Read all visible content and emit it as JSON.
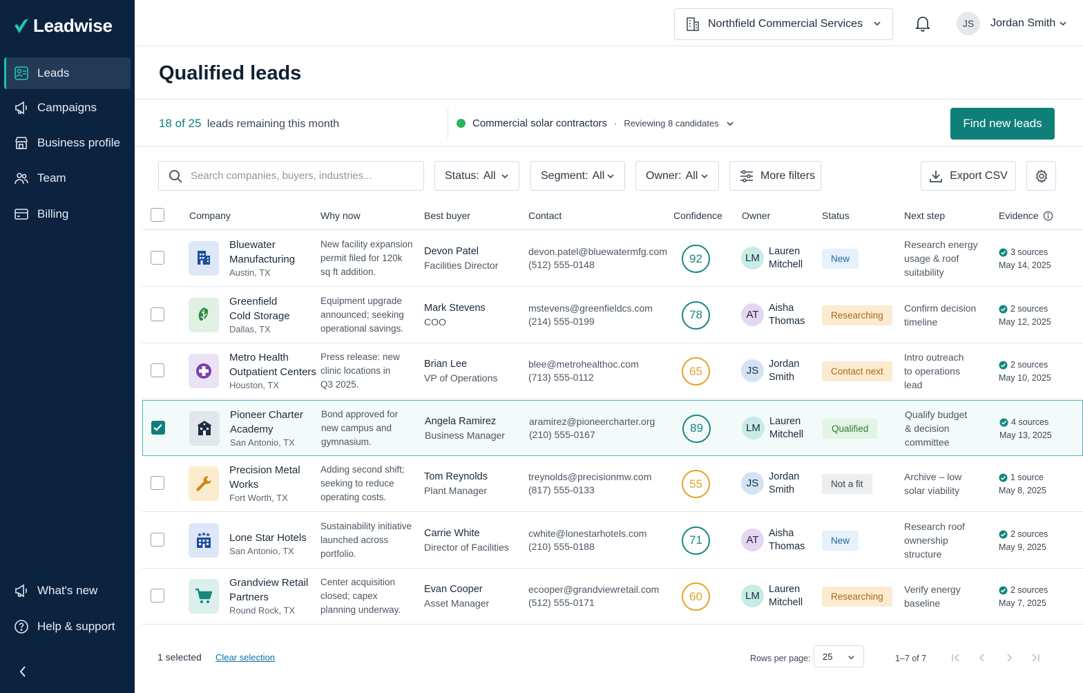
{
  "app": {
    "name": "Leadwise"
  },
  "nav": {
    "items": [
      {
        "label": "Leads",
        "icon": "leads-icon",
        "active": true
      },
      {
        "label": "Campaigns",
        "icon": "megaphone-icon"
      },
      {
        "label": "Business profile",
        "icon": "storefront-icon"
      },
      {
        "label": "Team",
        "icon": "team-icon"
      },
      {
        "label": "Billing",
        "icon": "credit-card-icon"
      }
    ],
    "bottom": [
      {
        "label": "What's new",
        "icon": "megaphone-icon"
      },
      {
        "label": "Help & support",
        "icon": "help-circle-icon"
      }
    ]
  },
  "topbar": {
    "org": "Northfield Commercial Services",
    "user_initials": "JS",
    "user_name": "Jordan Smith"
  },
  "page": {
    "title": "Qualified leads"
  },
  "summary": {
    "quota_count": "18 of 25",
    "quota_text": "leads remaining this month",
    "campaign_name": "Commercial solar contractors",
    "campaign_status": "Reviewing 8 candidates",
    "find_button": "Find new leads"
  },
  "toolbar": {
    "search_placeholder": "Search companies, buyers, industries...",
    "status_filter": {
      "label": "Status:",
      "value": "All"
    },
    "segment_filter": {
      "label": "Segment:",
      "value": "All"
    },
    "owner_filter": {
      "label": "Owner:",
      "value": "All"
    },
    "more_filters": "More filters",
    "export": "Export CSV"
  },
  "table": {
    "columns": [
      "Company",
      "Why now",
      "Best buyer",
      "Contact",
      "Confidence",
      "Owner",
      "Status",
      "Next step",
      "Evidence"
    ],
    "rows": [
      {
        "company": [
          "Bluewater",
          "Manufacturing"
        ],
        "location": "Austin, TX",
        "logo_icon": "building-icon",
        "logo_bg": "#dde7f7",
        "logo_color": "#1f4fa0",
        "why": [
          "New facility expansion",
          "permit filed for 120k",
          "sq ft addition."
        ],
        "buyer": "Devon Patel",
        "buyer_title": "Facilities Director",
        "email": "devon.patel@bluewatermfg.com",
        "phone": "(512) 555-0148",
        "confidence": 92,
        "owner_initials": "LM",
        "owner": [
          "Lauren",
          "Mitchell"
        ],
        "status": "New",
        "next": [
          "Research energy",
          "usage & roof",
          "suitability"
        ],
        "sources": "3 sources",
        "date": "May 14, 2025",
        "selected": false
      },
      {
        "company": [
          "Greenfield",
          "Cold Storage"
        ],
        "location": "Dallas, TX",
        "logo_icon": "leaf-icon",
        "logo_bg": "#e0f1e4",
        "logo_color": "#2f8a45",
        "why": [
          "Equipment upgrade",
          "announced; seeking",
          "operational savings."
        ],
        "buyer": "Mark Stevens",
        "buyer_title": "COO",
        "email": "mstevens@greenfieldcs.com",
        "phone": "(214) 555-0199",
        "confidence": 78,
        "owner_initials": "AT",
        "owner": [
          "Aisha",
          "Thomas"
        ],
        "status": "Researching",
        "next": [
          "Confirm decision",
          "timeline"
        ],
        "sources": "2 sources",
        "date": "May 12, 2025",
        "selected": false
      },
      {
        "company": [
          "Metro Health",
          "Outpatient Centers"
        ],
        "location": "Houston, TX",
        "logo_icon": "medical-cross-icon",
        "logo_bg": "#ece2f6",
        "logo_color": "#7a3fb0",
        "why": [
          "Press release: new",
          "clinic locations in",
          "Q3 2025."
        ],
        "buyer": "Brian Lee",
        "buyer_title": "VP of Operations",
        "email": "blee@metrohealthoc.com",
        "phone": "(713) 555-0112",
        "confidence": 65,
        "owner_initials": "JS",
        "owner": [
          "Jordan",
          "Smith"
        ],
        "status": "Contact next",
        "next": [
          "Intro outreach",
          "to operations",
          "lead"
        ],
        "sources": "2 sources",
        "date": "May 10, 2025",
        "selected": false
      },
      {
        "company": [
          "Pioneer Charter",
          "Academy"
        ],
        "location": "San Antonio, TX",
        "logo_icon": "school-icon",
        "logo_bg": "#e3e6ea",
        "logo_color": "#1d2f45",
        "why": [
          "Bond approved for",
          "new campus and",
          "gymnasium."
        ],
        "buyer": "Angela Ramirez",
        "buyer_title": "Business Manager",
        "email": "aramirez@pioneercharter.org",
        "phone": "(210) 555-0167",
        "confidence": 89,
        "owner_initials": "LM",
        "owner": [
          "Lauren",
          "Mitchell"
        ],
        "status": "Qualified",
        "next": [
          "Qualify budget",
          "& decision",
          "committee"
        ],
        "sources": "4 sources",
        "date": "May 13, 2025",
        "selected": true
      },
      {
        "company": [
          "Precision Metal",
          "Works"
        ],
        "location": "Fort Worth, TX",
        "logo_icon": "wrench-icon",
        "logo_bg": "#fbeccd",
        "logo_color": "#c9891c",
        "why": [
          "Adding second shift;",
          "seeking to reduce",
          "operating costs."
        ],
        "buyer": "Tom Reynolds",
        "buyer_title": "Plant Manager",
        "email": "treynolds@precisionmw.com",
        "phone": "(817) 555-0133",
        "confidence": 55,
        "owner_initials": "JS",
        "owner": [
          "Jordan",
          "Smith"
        ],
        "status": "Not a fit",
        "next": [
          "Archive – low",
          "solar viability"
        ],
        "sources": "1 source",
        "date": "May 8, 2025",
        "selected": false
      },
      {
        "company": [
          "Lone Star Hotels"
        ],
        "location": "San Antonio, TX",
        "logo_icon": "hotel-icon",
        "logo_bg": "#dde7f7",
        "logo_color": "#1f4fa0",
        "why": [
          "Sustainability initiative",
          "launched across",
          "portfolio."
        ],
        "buyer": "Carrie White",
        "buyer_title": "Director of Facilities",
        "email": "cwhite@lonestarhotels.com",
        "phone": "(210) 555-0188",
        "confidence": 71,
        "owner_initials": "AT",
        "owner": [
          "Aisha",
          "Thomas"
        ],
        "status": "New",
        "next": [
          "Research roof",
          "ownership",
          "structure"
        ],
        "sources": "2 sources",
        "date": "May 9, 2025",
        "selected": false
      },
      {
        "company": [
          "Grandview Retail",
          "Partners"
        ],
        "location": "Round Rock, TX",
        "logo_icon": "shopping-cart-icon",
        "logo_bg": "#dcefec",
        "logo_color": "#16887c",
        "why": [
          "Center acquisition",
          "closed; capex",
          "planning underway."
        ],
        "buyer": "Evan Cooper",
        "buyer_title": "Asset Manager",
        "email": "ecooper@grandviewretail.com",
        "phone": "(512) 555-0171",
        "confidence": 60,
        "owner_initials": "LM",
        "owner": [
          "Lauren",
          "Mitchell"
        ],
        "status": "Researching",
        "next": [
          "Verify energy",
          "baseline"
        ],
        "sources": "2 sources",
        "date": "May 7, 2025",
        "selected": false
      }
    ]
  },
  "footer": {
    "selected": "1 selected",
    "clear": "Clear selection",
    "rows_per_page_label": "Rows per page:",
    "rows_per_page": "25",
    "range": "1–7 of 7"
  },
  "colors": {
    "accent": "#0f7f7a",
    "sidebar": "#0c2340",
    "conf_high": "#13877f",
    "conf_mid": "#e0a526",
    "status_new_bg": "#e6f1fb",
    "status_new_fg": "#2167a8",
    "status_research_bg": "#fcebd0",
    "status_research_fg": "#a76a10",
    "status_qualified_bg": "#e3f4e5",
    "status_qualified_fg": "#2b7a3d",
    "status_notfit_bg": "#eceef0",
    "status_notfit_fg": "#3d4753"
  }
}
